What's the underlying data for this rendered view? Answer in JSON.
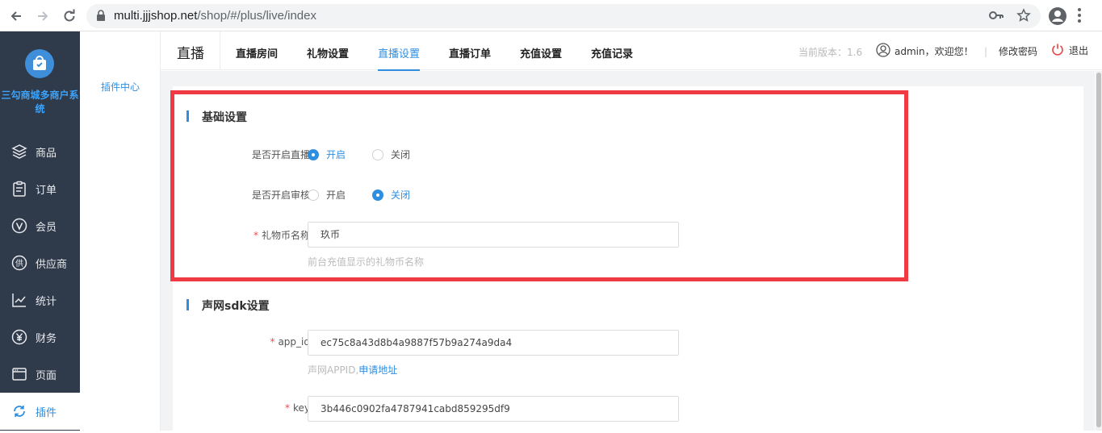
{
  "browser": {
    "url_host": "multi.jjjshop.net",
    "url_path": "/shop/#/plus/live/index"
  },
  "sidebar": {
    "brand": "三勾商城多商户系统",
    "items": [
      {
        "label": "商品",
        "icon": "layers-icon"
      },
      {
        "label": "订单",
        "icon": "clipboard-icon"
      },
      {
        "label": "会员",
        "icon": "vip-icon"
      },
      {
        "label": "供应商",
        "icon": "supplier-icon"
      },
      {
        "label": "统计",
        "icon": "chart-line-icon"
      },
      {
        "label": "财务",
        "icon": "yen-icon"
      },
      {
        "label": "页面",
        "icon": "window-icon"
      },
      {
        "label": "插件",
        "icon": "refresh-icon",
        "active": true
      }
    ]
  },
  "subside": {
    "item": "插件中心"
  },
  "topbar": {
    "title": "直播",
    "tabs": [
      "直播房间",
      "礼物设置",
      "直播设置",
      "直播订单",
      "充值设置",
      "充值记录"
    ],
    "active_tab": "直播设置",
    "version": "当前版本：1.6",
    "user": "admin，欢迎您！",
    "divider": "|",
    "change_password": "修改密码",
    "logout": "退出"
  },
  "basic": {
    "title": "基础设置",
    "live_label": "是否开启直播",
    "audit_label": "是否开启审核",
    "open": "开启",
    "close": "关闭",
    "live_value": "开启",
    "audit_value": "关闭",
    "coin_label": "礼物币名称",
    "coin_value": "玖币",
    "coin_hint": "前台充值显示的礼物币名称"
  },
  "sdk": {
    "title": "声网sdk设置",
    "app_id_label": "app_id",
    "app_id_value": "ec75c8a43d8b4a9887f57b9a274a9da4",
    "app_id_hint": "声网APPID,",
    "app_id_link": "申请地址",
    "key_label": "key",
    "key_value": "3b446c0902fa4787941cabd859295df9"
  },
  "required_mark": "*",
  "colors": {
    "accent": "#2f8ee0",
    "sidebar_bg": "#2f3a4a",
    "highlight": "#ef3a44"
  }
}
